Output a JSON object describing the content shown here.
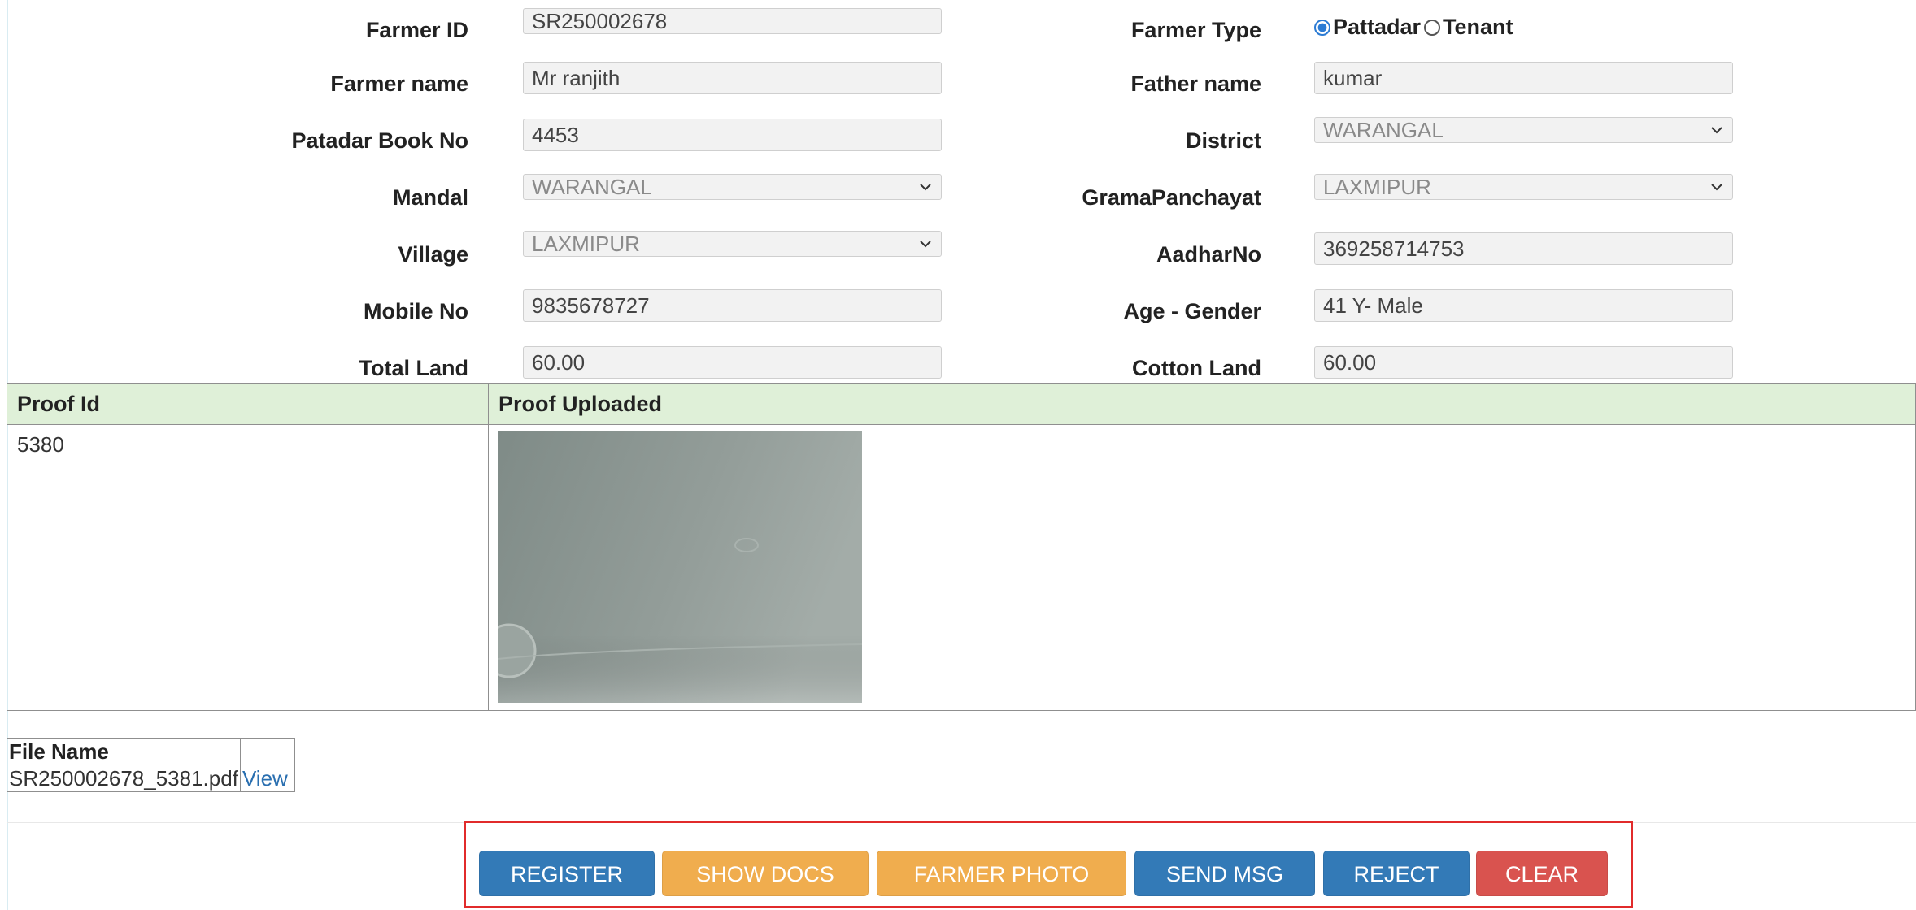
{
  "form": {
    "farmer_id": {
      "label": "Farmer ID",
      "value": "SR250002678"
    },
    "farmer_type": {
      "label": "Farmer Type",
      "options": [
        "Pattadar",
        "Tenant"
      ],
      "selected": "Pattadar"
    },
    "farmer_name": {
      "label": "Farmer name",
      "value": "Mr ranjith"
    },
    "father_name": {
      "label": "Father name",
      "value": "kumar"
    },
    "patadar_book_no": {
      "label": "Patadar Book No",
      "value": "4453"
    },
    "district": {
      "label": "District",
      "value": "WARANGAL"
    },
    "mandal": {
      "label": "Mandal",
      "value": "WARANGAL"
    },
    "grama_panchayat": {
      "label": "GramaPanchayat",
      "value": "LAXMIPUR"
    },
    "village": {
      "label": "Village",
      "value": "LAXMIPUR"
    },
    "aadhar_no": {
      "label": "AadharNo",
      "value": "369258714753"
    },
    "mobile_no": {
      "label": "Mobile No",
      "value": "9835678727"
    },
    "age_gender": {
      "label": "Age - Gender",
      "value": "41 Y- Male"
    },
    "total_land": {
      "label": "Total Land",
      "value": "60.00"
    },
    "cotton_land": {
      "label": "Cotton Land",
      "value": "60.00"
    }
  },
  "proof_table": {
    "headers": [
      "Proof Id",
      "Proof Uploaded"
    ],
    "rows": [
      {
        "proof_id": "5380"
      }
    ]
  },
  "file_table": {
    "header": "File Name",
    "rows": [
      {
        "file_name": "SR250002678_5381.pdf",
        "link": "View"
      }
    ]
  },
  "buttons": {
    "register": "REGISTER",
    "show_docs": "SHOW DOCS",
    "farmer_photo": "FARMER PHOTO",
    "send_msg": "SEND MSG",
    "reject": "REJECT",
    "clear": "CLEAR"
  },
  "colors": {
    "primary": "#337ab7",
    "warning": "#f0ad4e",
    "danger": "#d9534f",
    "table_header_bg": "#dff0d8",
    "highlight_frame": "#e12b2b",
    "radio_selected": "#2b7bd4",
    "link": "#2a6fb0"
  },
  "icons": {
    "select_caret": "chevron-down-icon",
    "radio_on": "radio-selected-icon",
    "radio_off": "radio-unselected-icon"
  }
}
